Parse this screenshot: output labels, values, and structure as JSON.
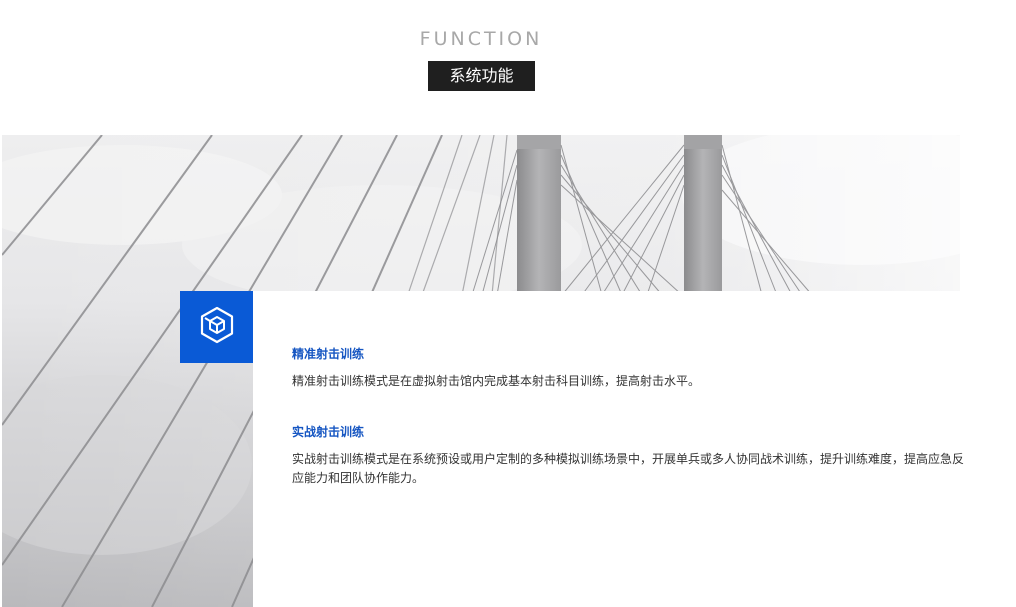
{
  "section": {
    "eyebrow": "FUNCTION",
    "title": "系统功能"
  },
  "colors": {
    "accent": "#0a5ad6",
    "feature_title": "#1656c2",
    "title_bg": "#1f1f1f"
  },
  "icon": "cube-icon",
  "features": [
    {
      "title": "精准射击训练",
      "description": "精准射击训练模式是在虚拟射击馆内完成基本射击科目训练，提高射击水平。"
    },
    {
      "title": "实战射击训练",
      "description": "实战射击训练模式是在系统预设或用户定制的多种模拟训练场景中，开展单兵或多人协同战术训练，提升训练难度，提高应急反应能力和团队协作能力。"
    }
  ]
}
